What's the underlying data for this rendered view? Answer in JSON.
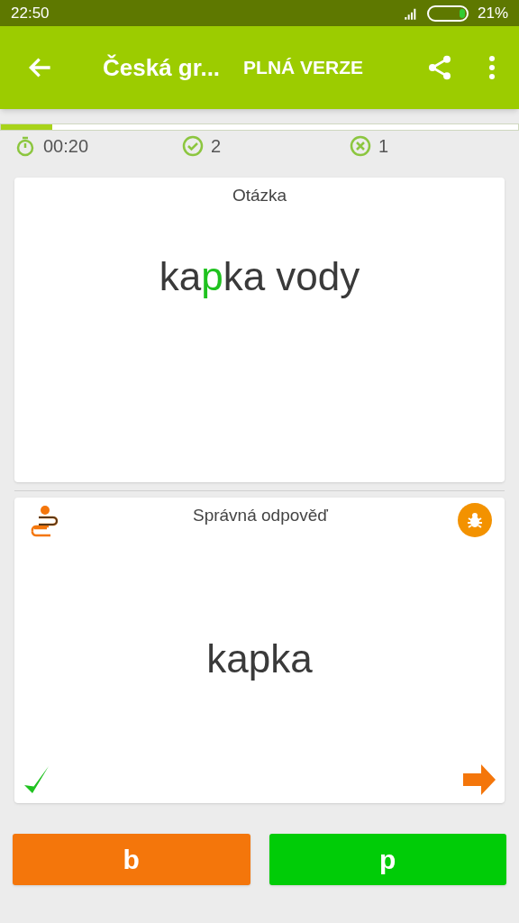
{
  "status_bar": {
    "time": "22:50",
    "battery": "21%"
  },
  "app_bar": {
    "title": "Česká gr...",
    "action": "PLNÁ VERZE"
  },
  "progress": {
    "level": 0.1
  },
  "stats": {
    "time": "00:20",
    "correct": "2",
    "wrong": "1"
  },
  "question_card": {
    "label": "Otázka",
    "parts": [
      {
        "text": "ka",
        "highlight": false
      },
      {
        "text": "p",
        "highlight": true
      },
      {
        "text": "ka vody",
        "highlight": false
      }
    ]
  },
  "answer_card": {
    "label": "Správná odpověď",
    "answer": "kapka",
    "correct": true
  },
  "answers": [
    {
      "label": "b",
      "color": "#f4760b"
    },
    {
      "label": "p",
      "color": "#00cc07"
    }
  ]
}
